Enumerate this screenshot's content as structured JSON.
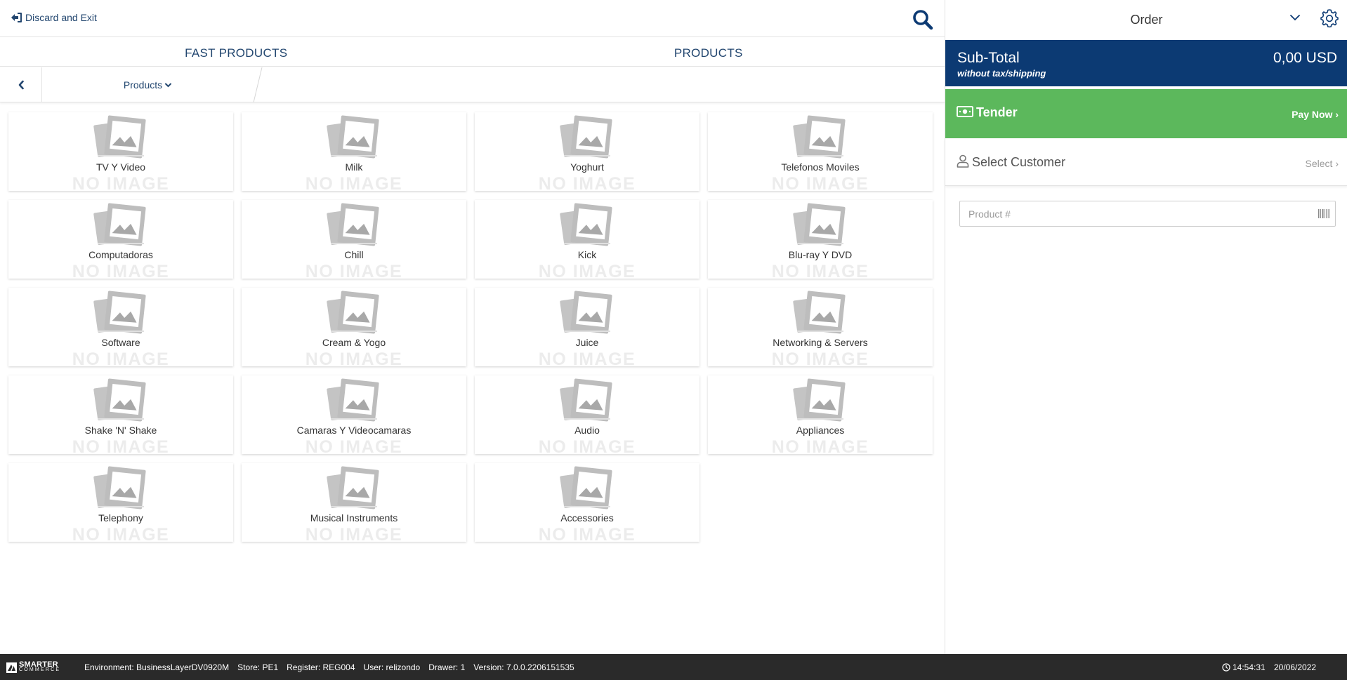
{
  "topbar": {
    "discard_label": "Discard and Exit"
  },
  "tabs": [
    {
      "label": "FAST PRODUCTS"
    },
    {
      "label": "PRODUCTS"
    }
  ],
  "breadcrumb": {
    "label": "Products"
  },
  "no_image_text": "NO IMAGE",
  "categories": [
    {
      "name": "TV Y Video"
    },
    {
      "name": "Milk"
    },
    {
      "name": "Yoghurt"
    },
    {
      "name": "Telefonos Moviles"
    },
    {
      "name": "Computadoras"
    },
    {
      "name": "Chill"
    },
    {
      "name": "Kick"
    },
    {
      "name": "Blu-ray Y DVD"
    },
    {
      "name": "Software"
    },
    {
      "name": "Cream & Yogo"
    },
    {
      "name": "Juice"
    },
    {
      "name": "Networking & Servers"
    },
    {
      "name": "Shake 'N' Shake"
    },
    {
      "name": "Camaras Y Videocamaras"
    },
    {
      "name": "Audio"
    },
    {
      "name": "Appliances"
    },
    {
      "name": "Telephony"
    },
    {
      "name": "Musical Instruments"
    },
    {
      "name": "Accessories"
    }
  ],
  "order": {
    "title": "Order",
    "subtotal_label": "Sub-Total",
    "subtotal_note": "without tax/shipping",
    "subtotal_amount": "0,00 USD",
    "tender_label": "Tender",
    "pay_now_label": "Pay Now",
    "customer_label": "Select Customer",
    "customer_select_label": "Select",
    "product_placeholder": "Product #"
  },
  "status": {
    "logo_line1": "SMARTER",
    "logo_line2": "COMMERCE",
    "environment": "Environment: BusinessLayerDV0920M",
    "store": "Store: PE1",
    "register": "Register: REG004",
    "user": "User: relizondo",
    "drawer": "Drawer: 1",
    "version": "Version: 7.0.0.2206151535",
    "time": "14:54:31",
    "date": "20/06/2022"
  },
  "colors": {
    "primary_blue": "#0c3a73",
    "link_blue": "#22466f",
    "tender_green": "#5cb85c",
    "status_bar": "#2a2a2a"
  }
}
